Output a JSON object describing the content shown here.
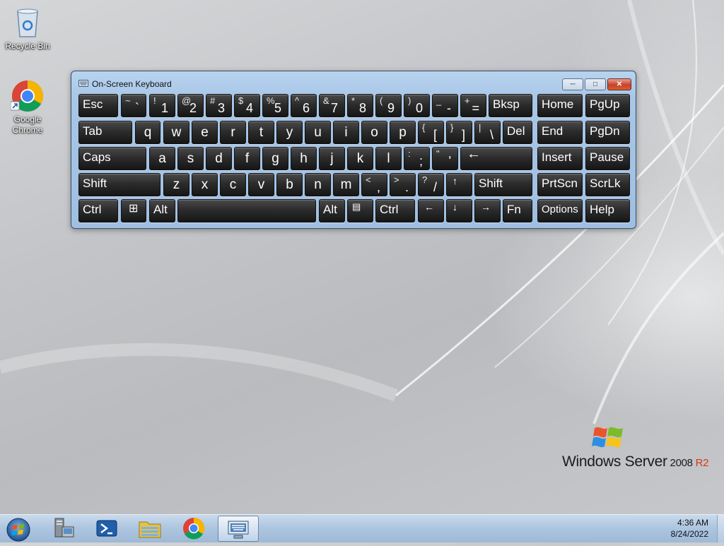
{
  "desktop": {
    "icons": [
      {
        "label": "Recycle Bin",
        "icon": "recycle-bin-icon"
      },
      {
        "label": "Google\nChrome",
        "line1": "Google",
        "line2": "Chrome",
        "icon": "chrome-icon"
      }
    ],
    "watermark": {
      "brand": "Windows Server",
      "version": " 2008 ",
      "release": "R2"
    }
  },
  "osk": {
    "title": "On-Screen Keyboard",
    "buttons": {
      "minimize": "minimize-icon",
      "maximize": "maximize-icon",
      "close": "close-icon"
    },
    "rows": [
      [
        {
          "type": "label",
          "text": "Esc"
        },
        {
          "type": "sym",
          "shift": "~",
          "main": "`"
        },
        {
          "type": "sym",
          "shift": "!",
          "main": "1"
        },
        {
          "type": "sym",
          "shift": "@",
          "main": "2"
        },
        {
          "type": "sym",
          "shift": "#",
          "main": "3"
        },
        {
          "type": "sym",
          "shift": "$",
          "main": "4"
        },
        {
          "type": "sym",
          "shift": "%",
          "main": "5"
        },
        {
          "type": "sym",
          "shift": "^",
          "main": "6"
        },
        {
          "type": "sym",
          "shift": "&",
          "main": "7"
        },
        {
          "type": "sym",
          "shift": "*",
          "main": "8"
        },
        {
          "type": "sym",
          "shift": "(",
          "main": "9"
        },
        {
          "type": "sym",
          "shift": ")",
          "main": "0"
        },
        {
          "type": "sym",
          "shift": "_",
          "main": "-"
        },
        {
          "type": "sym",
          "shift": "+",
          "main": "="
        },
        {
          "type": "label",
          "text": "Bksp"
        },
        {
          "type": "label",
          "text": "Home"
        },
        {
          "type": "label",
          "text": "PgUp"
        }
      ],
      [
        {
          "type": "label",
          "text": "Tab"
        },
        {
          "type": "letter",
          "text": "q"
        },
        {
          "type": "letter",
          "text": "w"
        },
        {
          "type": "letter",
          "text": "e"
        },
        {
          "type": "letter",
          "text": "r"
        },
        {
          "type": "letter",
          "text": "t"
        },
        {
          "type": "letter",
          "text": "y"
        },
        {
          "type": "letter",
          "text": "u"
        },
        {
          "type": "letter",
          "text": "i"
        },
        {
          "type": "letter",
          "text": "o"
        },
        {
          "type": "letter",
          "text": "p"
        },
        {
          "type": "sym",
          "shift": "{",
          "main": "["
        },
        {
          "type": "sym",
          "shift": "}",
          "main": "]"
        },
        {
          "type": "sym",
          "shift": "|",
          "main": "\\"
        },
        {
          "type": "label",
          "text": "Del"
        },
        {
          "type": "label",
          "text": "End"
        },
        {
          "type": "label",
          "text": "PgDn"
        }
      ],
      [
        {
          "type": "label",
          "text": "Caps"
        },
        {
          "type": "letter",
          "text": "a"
        },
        {
          "type": "letter",
          "text": "s"
        },
        {
          "type": "letter",
          "text": "d"
        },
        {
          "type": "letter",
          "text": "f"
        },
        {
          "type": "letter",
          "text": "g"
        },
        {
          "type": "letter",
          "text": "h"
        },
        {
          "type": "letter",
          "text": "j"
        },
        {
          "type": "letter",
          "text": "k"
        },
        {
          "type": "letter",
          "text": "l"
        },
        {
          "type": "sym",
          "shift": ":",
          "main": ";"
        },
        {
          "type": "sym",
          "shift": "\"",
          "main": "'"
        },
        {
          "type": "icon",
          "icon": "enter-arrow-icon",
          "glyph": "←"
        },
        {
          "type": "label",
          "text": "Insert"
        },
        {
          "type": "label",
          "text": "Pause"
        }
      ],
      [
        {
          "type": "label",
          "text": "Shift"
        },
        {
          "type": "letter",
          "text": "z"
        },
        {
          "type": "letter",
          "text": "x"
        },
        {
          "type": "letter",
          "text": "c"
        },
        {
          "type": "letter",
          "text": "v"
        },
        {
          "type": "letter",
          "text": "b"
        },
        {
          "type": "letter",
          "text": "n"
        },
        {
          "type": "letter",
          "text": "m"
        },
        {
          "type": "sym",
          "shift": "<",
          "main": ","
        },
        {
          "type": "sym",
          "shift": ">",
          "main": "."
        },
        {
          "type": "sym",
          "shift": "?",
          "main": "/"
        },
        {
          "type": "icon",
          "icon": "up-arrow-icon",
          "glyph": "↑"
        },
        {
          "type": "label",
          "text": "Shift"
        },
        {
          "type": "label",
          "text": "PrtScn"
        },
        {
          "type": "label",
          "text": "ScrLk"
        }
      ],
      [
        {
          "type": "label",
          "text": "Ctrl"
        },
        {
          "type": "icon",
          "icon": "windows-logo-icon",
          "glyph": "⊞"
        },
        {
          "type": "label",
          "text": "Alt"
        },
        {
          "type": "label",
          "text": ""
        },
        {
          "type": "label",
          "text": "Alt"
        },
        {
          "type": "icon",
          "icon": "context-menu-icon",
          "glyph": "▤"
        },
        {
          "type": "label",
          "text": "Ctrl"
        },
        {
          "type": "icon",
          "icon": "left-arrow-icon",
          "glyph": "←"
        },
        {
          "type": "icon",
          "icon": "down-arrow-icon",
          "glyph": "↓"
        },
        {
          "type": "icon",
          "icon": "right-arrow-icon",
          "glyph": "→"
        },
        {
          "type": "label",
          "text": "Fn"
        },
        {
          "type": "label",
          "text": "Options",
          "small": true
        },
        {
          "type": "label",
          "text": "Help"
        }
      ]
    ]
  },
  "taskbar": {
    "items": [
      {
        "icon": "server-manager-icon",
        "active": false
      },
      {
        "icon": "powershell-icon",
        "active": false
      },
      {
        "icon": "file-explorer-icon",
        "active": false
      },
      {
        "icon": "chrome-icon",
        "active": false
      },
      {
        "icon": "on-screen-keyboard-icon",
        "active": true
      }
    ],
    "clock": {
      "time": "4:36 AM",
      "date": "8/24/2022"
    }
  }
}
